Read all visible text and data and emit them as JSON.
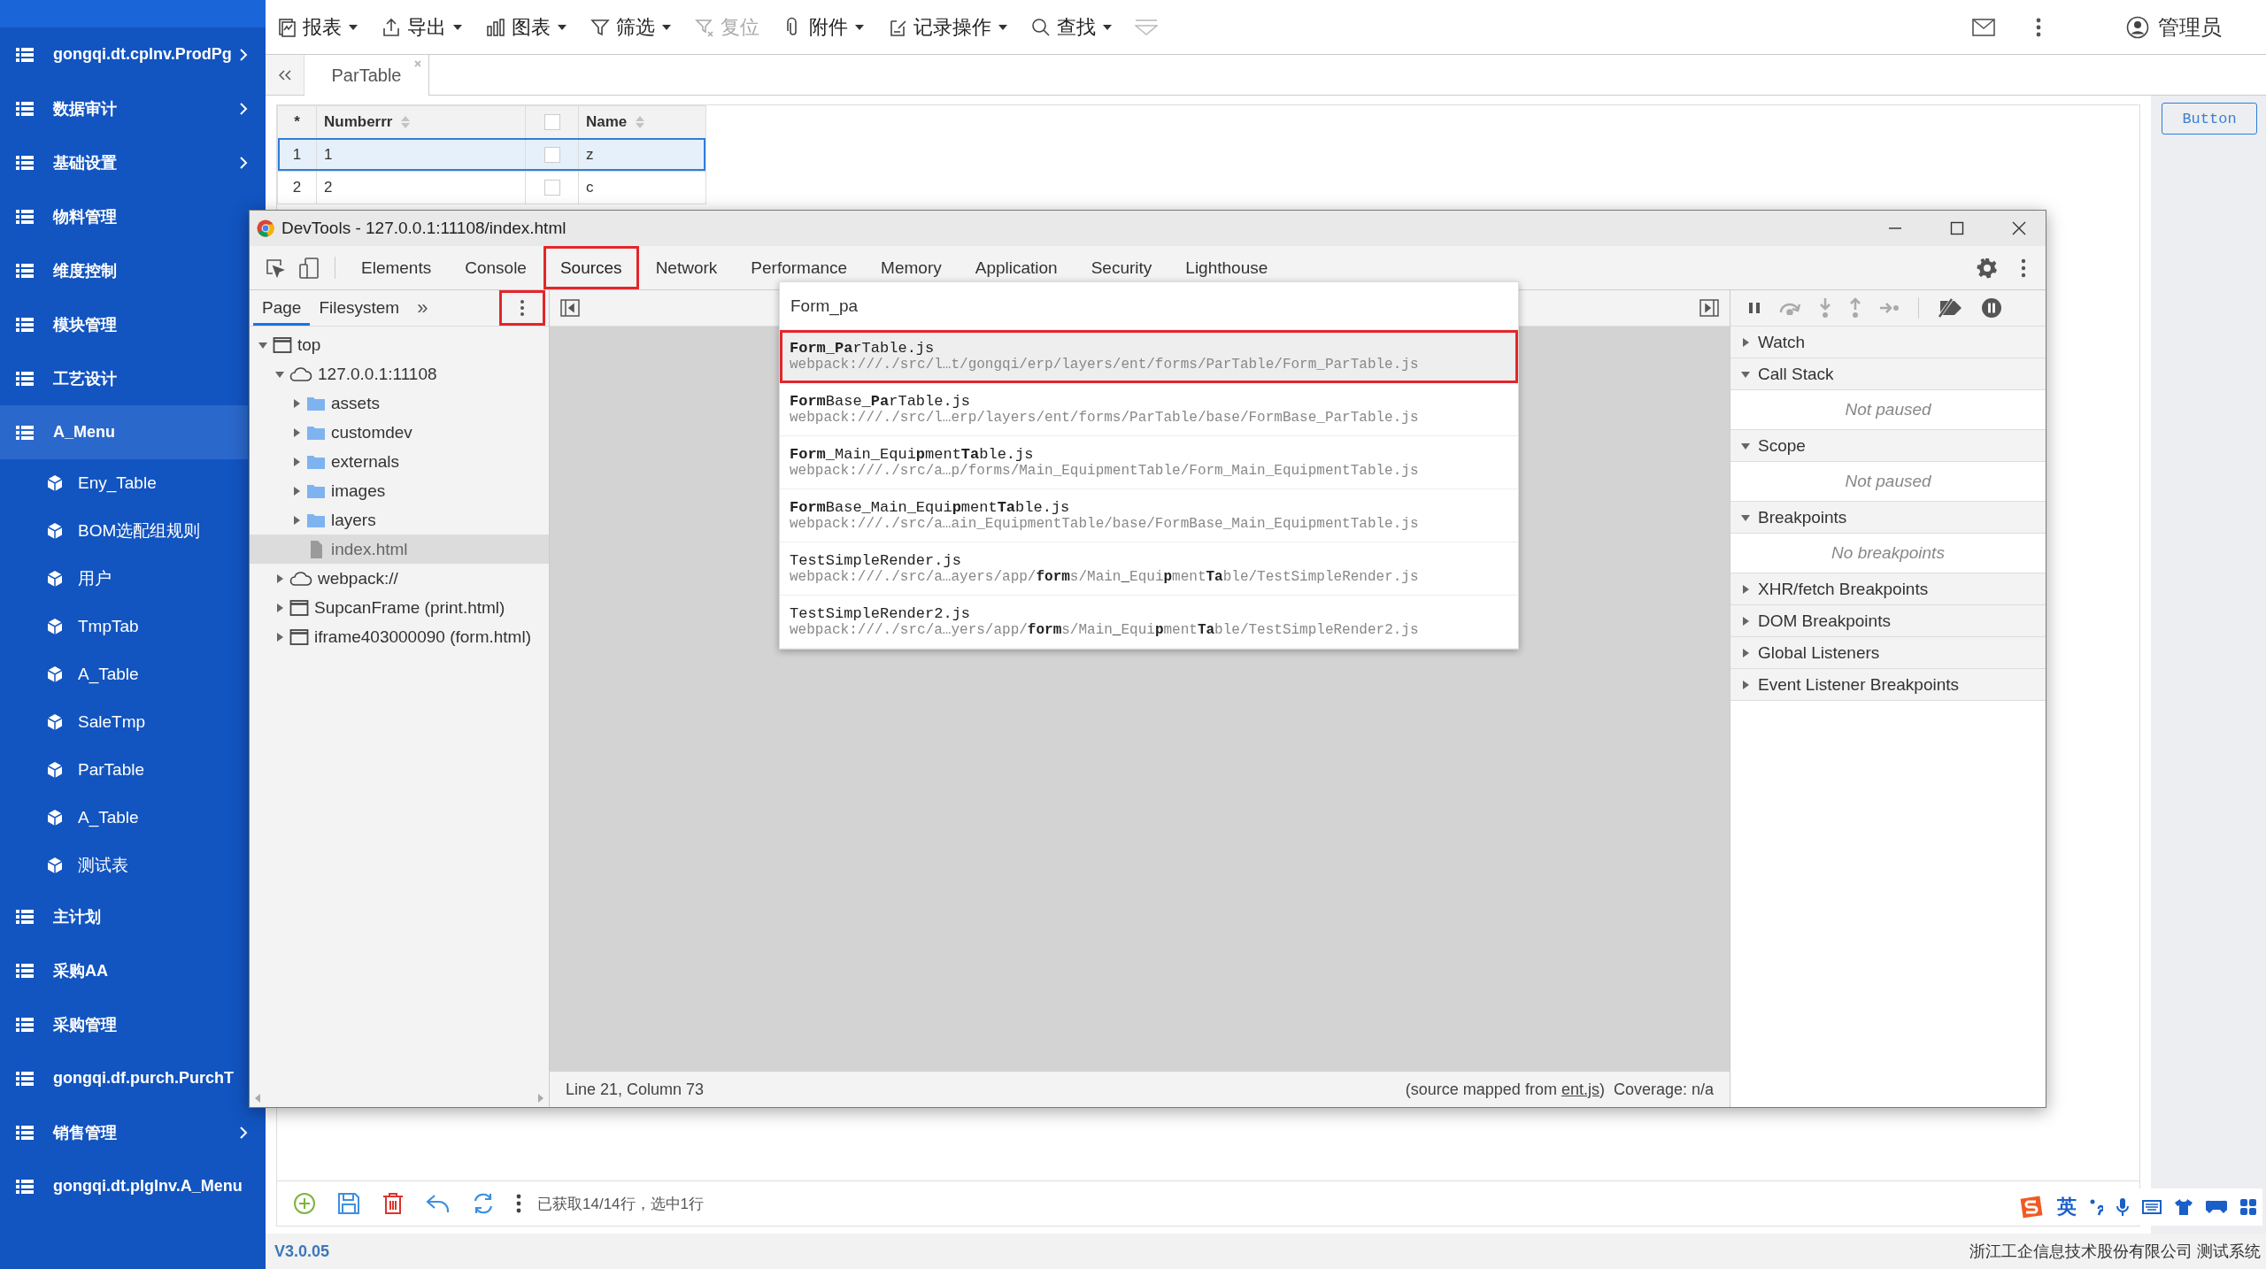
{
  "sidebar": {
    "items": [
      {
        "label": "gongqi.dt.cplnv.ProdPg",
        "expandable": true,
        "selected": false
      },
      {
        "label": "数据审计",
        "expandable": true,
        "selected": false
      },
      {
        "label": "基础设置",
        "expandable": true,
        "selected": false
      },
      {
        "label": "物料管理",
        "expandable": false,
        "selected": false
      },
      {
        "label": "维度控制",
        "expandable": false,
        "selected": false
      },
      {
        "label": "模块管理",
        "expandable": false,
        "selected": false
      },
      {
        "label": "工艺设计",
        "expandable": false,
        "selected": false
      },
      {
        "label": "A_Menu",
        "expandable": false,
        "selected": true,
        "children": [
          {
            "label": "Eny_Table"
          },
          {
            "label": "BOM选配组规则"
          },
          {
            "label": "用户"
          },
          {
            "label": "TmpTab"
          },
          {
            "label": "A_Table"
          },
          {
            "label": "SaleTmp"
          },
          {
            "label": "ParTable"
          },
          {
            "label": "A_Table"
          },
          {
            "label": "测试表"
          }
        ]
      },
      {
        "label": "主计划",
        "expandable": false,
        "selected": false
      },
      {
        "label": "采购AA",
        "expandable": false,
        "selected": false
      },
      {
        "label": "采购管理",
        "expandable": false,
        "selected": false
      },
      {
        "label": "gongqi.df.purch.PurchT",
        "expandable": false,
        "selected": false
      },
      {
        "label": "销售管理",
        "expandable": true,
        "selected": false
      },
      {
        "label": "gongqi.dt.plgInv.A_Menu",
        "expandable": false,
        "selected": false
      }
    ]
  },
  "toolbar": {
    "items": [
      {
        "kind": "report",
        "label": "报表",
        "dropdown": true,
        "disabled": false
      },
      {
        "kind": "export",
        "label": "导出",
        "dropdown": true,
        "disabled": false
      },
      {
        "kind": "chart",
        "label": "图表",
        "dropdown": true,
        "disabled": false
      },
      {
        "kind": "filter",
        "label": "筛选",
        "dropdown": true,
        "disabled": false
      },
      {
        "kind": "reset",
        "label": "复位",
        "dropdown": false,
        "disabled": true
      },
      {
        "kind": "attach",
        "label": "附件",
        "dropdown": true,
        "disabled": false
      },
      {
        "kind": "record",
        "label": "记录操作",
        "dropdown": true,
        "disabled": false
      },
      {
        "kind": "find",
        "label": "查找",
        "dropdown": true,
        "disabled": false
      }
    ],
    "user": "管理员"
  },
  "tabs": [
    {
      "label": "ParTable",
      "selected": true
    }
  ],
  "grid": {
    "columns": [
      {
        "kind": "index",
        "label": "*"
      },
      {
        "kind": "text",
        "label": "Numberrr"
      },
      {
        "kind": "check"
      },
      {
        "kind": "text",
        "label": "Name"
      }
    ],
    "rows": [
      {
        "index": "1",
        "number": "1",
        "checked": false,
        "name": "z",
        "selected": true
      },
      {
        "index": "2",
        "number": "2",
        "checked": false,
        "name": "c",
        "selected": false
      }
    ]
  },
  "side_button": "Button",
  "bottom_toolbar": {
    "summary": "已获取14/14行，选中1行"
  },
  "status_bar": {
    "version": "V3.0.05",
    "company": "浙江工企信息技术股份有限公司 测试系统"
  },
  "ime": {
    "mode": "英"
  },
  "devtools": {
    "title": "DevTools - 127.0.0.1:11108/index.html",
    "tabs": [
      {
        "label": "Elements",
        "selected": false,
        "highlighted": false
      },
      {
        "label": "Console",
        "selected": false,
        "highlighted": false
      },
      {
        "label": "Sources",
        "selected": true,
        "highlighted": true
      },
      {
        "label": "Network",
        "selected": false,
        "highlighted": false
      },
      {
        "label": "Performance",
        "selected": false,
        "highlighted": false
      },
      {
        "label": "Memory",
        "selected": false,
        "highlighted": false
      },
      {
        "label": "Application",
        "selected": false,
        "highlighted": false
      },
      {
        "label": "Security",
        "selected": false,
        "highlighted": false
      },
      {
        "label": "Lighthouse",
        "selected": false,
        "highlighted": false
      }
    ],
    "navigator": {
      "tabs": [
        {
          "label": "Page",
          "selected": true
        },
        {
          "label": "Filesystem",
          "selected": false
        }
      ],
      "more": "»",
      "menu_highlighted": true,
      "tree": [
        {
          "label": "top",
          "kind": "frame",
          "expanded": true,
          "selected": false,
          "children": [
            {
              "label": "127.0.0.1:11108",
              "kind": "cloud",
              "expanded": true,
              "selected": false,
              "children": [
                {
                  "label": "assets",
                  "kind": "folder",
                  "expanded": false,
                  "selected": false
                },
                {
                  "label": "customdev",
                  "kind": "folder",
                  "expanded": false,
                  "selected": false
                },
                {
                  "label": "externals",
                  "kind": "folder",
                  "expanded": false,
                  "selected": false
                },
                {
                  "label": "images",
                  "kind": "folder",
                  "expanded": false,
                  "selected": false
                },
                {
                  "label": "layers",
                  "kind": "folder",
                  "expanded": false,
                  "selected": false
                },
                {
                  "label": "index.html",
                  "kind": "file",
                  "selected": true
                }
              ]
            },
            {
              "label": "webpack://",
              "kind": "cloud",
              "expanded": false,
              "selected": false
            },
            {
              "label": "SupcanFrame (print.html)",
              "kind": "frame",
              "expanded": false,
              "selected": false
            },
            {
              "label": "iframe403000090 (form.html)",
              "kind": "frame",
              "expanded": false,
              "selected": false
            }
          ]
        }
      ]
    },
    "quick_open": {
      "query": "Form_pa",
      "results": [
        {
          "title": "**Form_Pa**rTable.js",
          "path": "webpack:///./src/l…t/gongqi/erp/layers/ent/forms/ParTable/Form_ParTable.js",
          "selected": true,
          "highlighted": true
        },
        {
          "title": "**Form**Base_**Pa**rTable.js",
          "path": "webpack:///./src/l…erp/layers/ent/forms/ParTable/base/FormBase_ParTable.js",
          "selected": false,
          "highlighted": false
        },
        {
          "title": "**Form_**Main_Equi**p**ment**Ta**ble.js",
          "path": "webpack:///./src/a…p/forms/Main_EquipmentTable/Form_Main_EquipmentTable.js",
          "selected": false,
          "highlighted": false
        },
        {
          "title": "**Form**Base_Main**_**Equi**p**ment**Ta**ble.js",
          "path": "webpack:///./src/a…ain_EquipmentTable/base/FormBase_Main_EquipmentTable.js",
          "selected": false,
          "highlighted": false
        },
        {
          "title": "TestSimpleRender.js",
          "path": "webpack:///./src/a…ayers/app/**form**s/Main**_**Equi**p**ment**Ta**ble/TestSimpleRender.js",
          "selected": false,
          "highlighted": false
        },
        {
          "title": "TestSimpleRender2.js",
          "path": "webpack:///./src/a…yers/app/**form**s/Main**_**Equi**p**ment**Ta**ble/TestSimpleRender2.js",
          "selected": false,
          "highlighted": false
        }
      ]
    },
    "editor_status": {
      "position": "Line 21, Column 73",
      "source_prefix": "(source mapped from",
      "source_link": "ent.js",
      "source_suffix": ")",
      "coverage": "Coverage: n/a"
    },
    "debugger": {
      "sections": [
        {
          "label": "Watch",
          "expanded": false
        },
        {
          "label": "Call Stack",
          "expanded": true,
          "message": "Not paused"
        },
        {
          "label": "Scope",
          "expanded": true,
          "message": "Not paused"
        },
        {
          "label": "Breakpoints",
          "expanded": true,
          "message": "No breakpoints"
        },
        {
          "label": "XHR/fetch Breakpoints",
          "expanded": false
        },
        {
          "label": "DOM Breakpoints",
          "expanded": false
        },
        {
          "label": "Global Listeners",
          "expanded": false
        },
        {
          "label": "Event Listener Breakpoints",
          "expanded": false
        }
      ]
    }
  }
}
